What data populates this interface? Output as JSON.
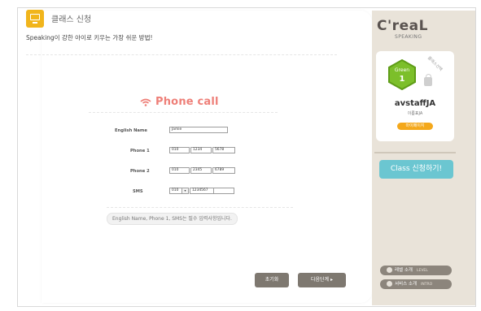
{
  "header": {
    "title": "클래스 신청",
    "icon": "monitor-icon"
  },
  "subtitle": "Speaking이 강한 아이로 키우는 가장 쉬운 방법!",
  "phone_call": {
    "title": "Phone call",
    "icon": "wifi-icon",
    "title_color": "#ee7f78"
  },
  "form": {
    "english_name": {
      "label": "English Name",
      "value": "Jamie"
    },
    "phone1": {
      "label": "Phone 1",
      "parts": [
        "010",
        "1234",
        "5678"
      ]
    },
    "phone2": {
      "label": "Phone 2",
      "parts": [
        "010",
        "2345",
        "6789"
      ]
    },
    "sms": {
      "label": "SMS",
      "prefix": "010",
      "parts": [
        "1234567",
        ""
      ]
    }
  },
  "notice": "English Name, Phone 1, SMS는 필수 입력사항입니다.",
  "buttons": {
    "reset": "초기화",
    "next": "다음단계 ▸"
  },
  "sidebar": {
    "logo": "C'reaL",
    "logo_sub": "SPEAKING",
    "ribbon": "클래스선택",
    "level": {
      "name": "Green",
      "number": "1",
      "color": "#7cbf2a"
    },
    "username": "avstaffJA",
    "nickname": "이름표JA",
    "mypage": "마이페이지",
    "class_btn": "Class 신청하기!",
    "class_btn_color": "#6bc6d1",
    "level_intro": {
      "label": "레벨 소개",
      "tag": "LEVEL"
    },
    "service_intro": {
      "label": "서비스 소개",
      "tag": "INTRO"
    }
  }
}
